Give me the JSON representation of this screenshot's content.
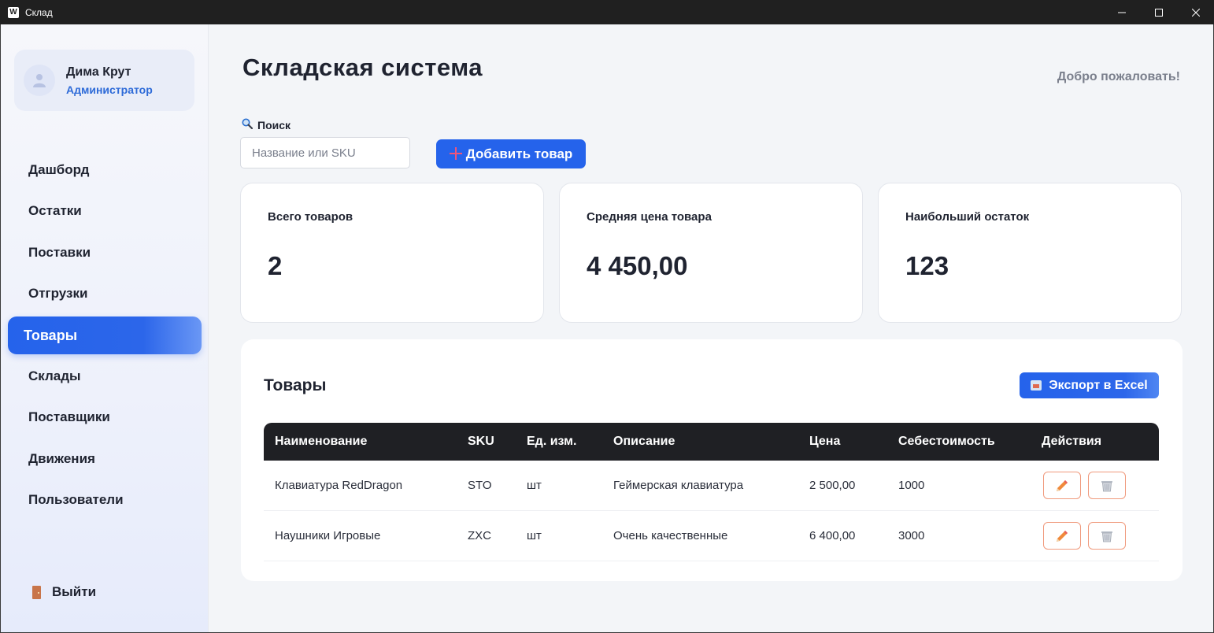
{
  "window": {
    "title": "Склад",
    "app_icon_letter": "W"
  },
  "sidebar": {
    "profile": {
      "name": "Дима Крут",
      "role": "Администратор"
    },
    "items": [
      {
        "label": "Дашборд",
        "active": false
      },
      {
        "label": "Остатки",
        "active": false
      },
      {
        "label": "Поставки",
        "active": false
      },
      {
        "label": "Отгрузки",
        "active": false
      },
      {
        "label": "Товары",
        "active": true
      },
      {
        "label": "Склады",
        "active": false
      },
      {
        "label": "Поставщики",
        "active": false
      },
      {
        "label": "Движения",
        "active": false
      },
      {
        "label": "Пользователи",
        "active": false
      }
    ],
    "logout_label": "Выйти"
  },
  "header": {
    "title": "Складская система",
    "welcome": "Добро пожаловать!"
  },
  "search": {
    "label": "Поиск",
    "placeholder": "Название или SKU",
    "value": ""
  },
  "toolbar": {
    "add_label": "Добавить товар"
  },
  "stats": [
    {
      "label": "Всего товаров",
      "value": "2"
    },
    {
      "label": "Средняя цена товара",
      "value": "4 450,00"
    },
    {
      "label": "Наибольший остаток",
      "value": "123"
    }
  ],
  "products": {
    "title": "Товары",
    "export_label": "Экспорт в Excel",
    "columns": [
      "Наименование",
      "SKU",
      "Ед. изм.",
      "Описание",
      "Цена",
      "Себестоимость",
      "Действия"
    ],
    "rows": [
      {
        "name": "Клавиатура RedDragon",
        "sku": "STO",
        "unit": "шт",
        "description": "Геймерская клавиатура",
        "price": "2 500,00",
        "cost": "1000"
      },
      {
        "name": "Наушники Игровые",
        "sku": "ZXC",
        "unit": "шт",
        "description": "Очень качественные",
        "price": "6 400,00",
        "cost": "3000"
      }
    ]
  },
  "colors": {
    "accent": "#2563eb",
    "dark_header": "#1f2024",
    "action_border": "#f09a7d"
  },
  "icons": {
    "edit": "pencil-icon",
    "delete": "trash-icon",
    "search": "magnifier-icon",
    "add": "plus-icon",
    "export": "export-icon",
    "logout": "door-icon",
    "profile": "user-icon"
  }
}
